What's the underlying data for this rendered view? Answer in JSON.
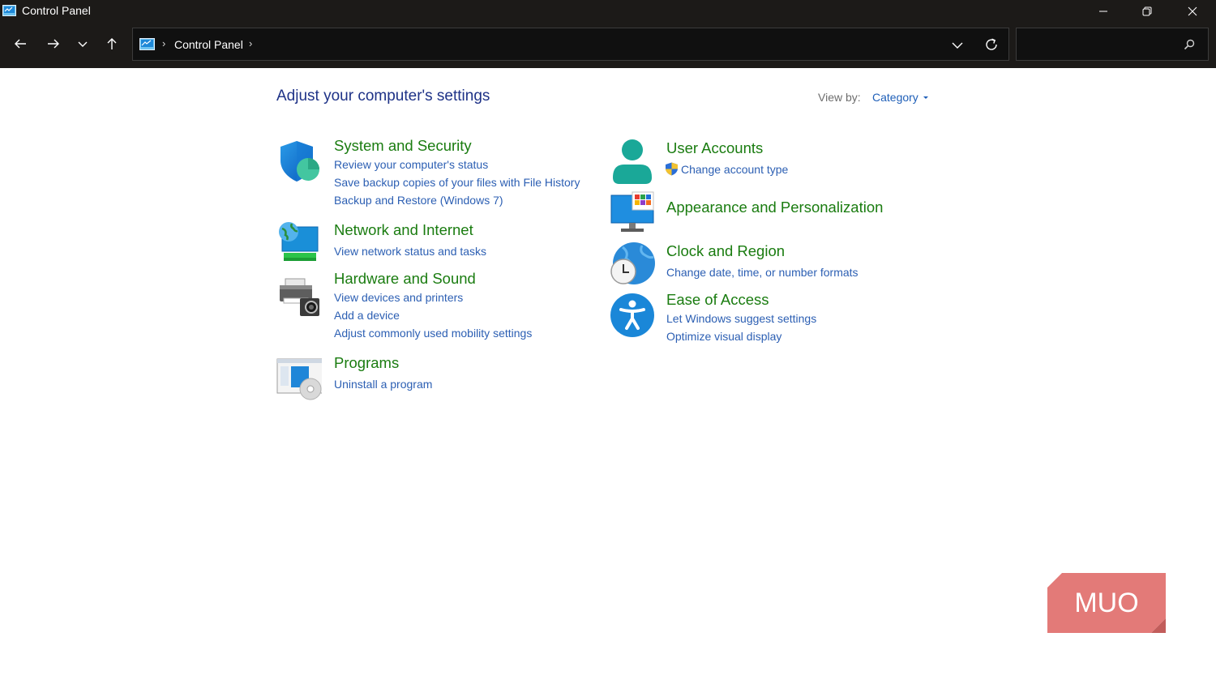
{
  "window": {
    "title": "Control Panel",
    "minimize_icon": "minimize-icon",
    "restore_icon": "restore-icon",
    "close_icon": "close-icon"
  },
  "navigation": {
    "back_icon": "arrow-left-icon",
    "forward_icon": "arrow-right-icon",
    "recent_icon": "chevron-down-icon",
    "up_icon": "arrow-up-icon"
  },
  "address_bar": {
    "breadcrumb": "Control Panel",
    "separator": "›",
    "dropdown_icon": "chevron-down-icon",
    "refresh_icon": "refresh-icon"
  },
  "search": {
    "value": "",
    "placeholder": "",
    "icon": "search-icon"
  },
  "content": {
    "heading": "Adjust your computer's settings",
    "view_by_label": "View by:",
    "view_by_value": "Category",
    "left_categories": [
      {
        "title": "System and Security",
        "icon": "shield-icon",
        "links": [
          "Review your computer's status",
          "Save backup copies of your files with File History",
          "Backup and Restore (Windows 7)"
        ]
      },
      {
        "title": "Network and Internet",
        "icon": "network-globe-icon",
        "links": [
          "View network status and tasks"
        ]
      },
      {
        "title": "Hardware and Sound",
        "icon": "printer-camera-icon",
        "links": [
          "View devices and printers",
          "Add a device",
          "Adjust commonly used mobility settings"
        ]
      },
      {
        "title": "Programs",
        "icon": "programs-disc-icon",
        "links": [
          "Uninstall a program"
        ]
      }
    ],
    "right_categories": [
      {
        "title": "User Accounts",
        "icon": "user-icon",
        "links": [
          "Change account type"
        ]
      },
      {
        "title": "Appearance and Personalization",
        "icon": "monitor-palette-icon",
        "links": []
      },
      {
        "title": "Clock and Region",
        "icon": "clock-globe-icon",
        "links": [
          "Change date, time, or number formats"
        ]
      },
      {
        "title": "Ease of Access",
        "icon": "accessibility-icon",
        "links": [
          "Let Windows suggest settings",
          "Optimize visual display"
        ]
      }
    ]
  },
  "watermark": {
    "text": "MUO",
    "color": "#e37a78"
  },
  "colors": {
    "titlebar": "#1c1a18",
    "heading": "#1e3287",
    "category_title": "#1a7c10",
    "link": "#2c5fb3"
  }
}
